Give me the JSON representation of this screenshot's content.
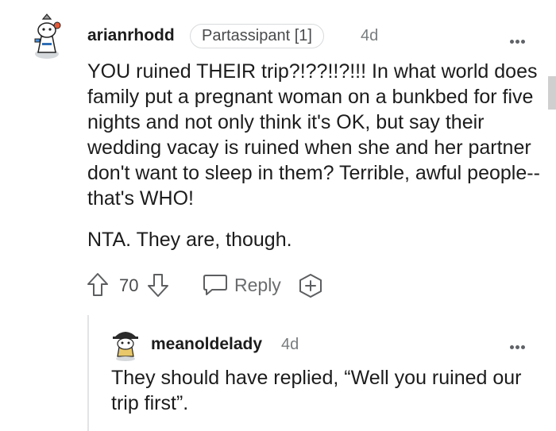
{
  "comment": {
    "username": "arianrhodd",
    "flair": "Partassipant [1]",
    "time": "4d",
    "paragraphs": [
      "YOU ruined THEIR trip?!??!!?!!! In what world does family put a pregnant woman on a bunkbed for five nights and not only think it's OK, but say their wedding vacay is ruined when she and her partner don't want to sleep in them? Terrible, awful people--that's WHO!",
      "NTA. They are, though."
    ],
    "vote_count": "70",
    "reply_label": "Reply",
    "icons": {
      "avatar": "snoo-avatar",
      "more": "more-options-icon",
      "upvote": "upvote-arrow-icon",
      "downvote": "downvote-arrow-icon",
      "reply": "reply-bubble-icon",
      "award": "add-award-icon"
    }
  },
  "reply": {
    "username": "meanoldelady",
    "time": "4d",
    "text": "They should have replied, “Well you ruined our trip first”.",
    "icons": {
      "avatar": "snoo-avatar-hat",
      "more": "more-options-icon"
    }
  },
  "colors": {
    "text": "#1c1c1c",
    "meta": "#787c7e",
    "border": "#d8dadc",
    "thread_line": "#e2e4e6"
  }
}
